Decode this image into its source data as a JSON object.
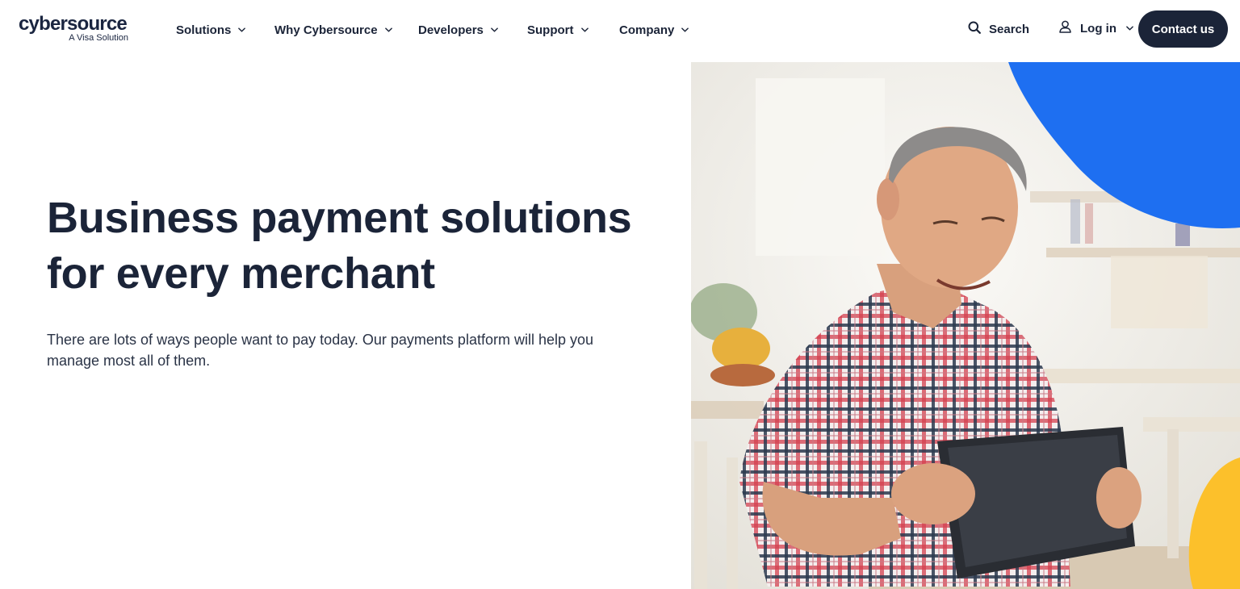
{
  "brand": {
    "name": "cybersource",
    "tagline": "A Visa Solution"
  },
  "nav": {
    "items": [
      {
        "label": "Solutions"
      },
      {
        "label": "Why Cybersource"
      },
      {
        "label": "Developers"
      },
      {
        "label": "Support"
      },
      {
        "label": "Company"
      }
    ],
    "search_label": "Search",
    "login_label": "Log in",
    "contact_label": "Contact us"
  },
  "hero": {
    "title": "Business payment solutions for every merchant",
    "subtitle": "There are lots of ways people want to pay today. Our payments platform will help you manage most all of them."
  },
  "icons": {
    "search": "search-icon",
    "user": "user-icon",
    "chevron": "chevron-down-icon"
  },
  "colors": {
    "navy": "#1b2438",
    "accent_blue": "#1e6ff1",
    "accent_yellow": "#fcc02b"
  }
}
